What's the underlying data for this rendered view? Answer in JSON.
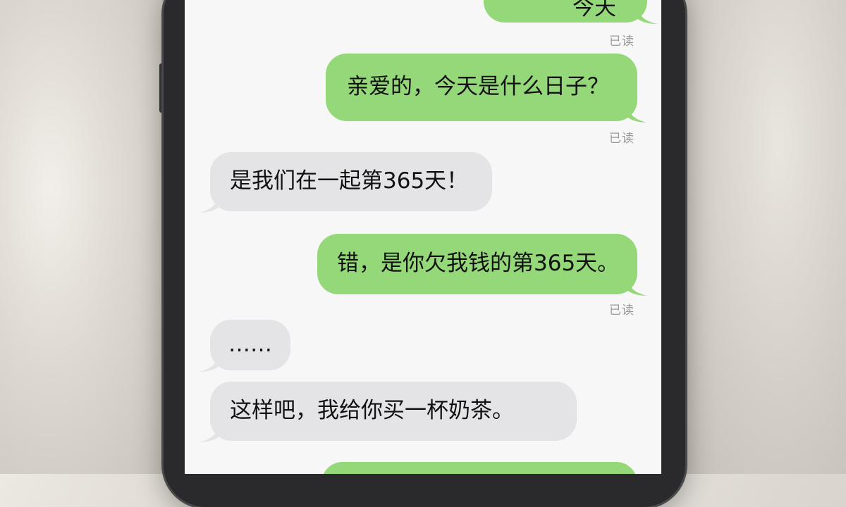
{
  "colors": {
    "outgoing_bubble": "#95d879",
    "incoming_bubble": "#e4e4e6",
    "screen_background": "#f7f7f7"
  },
  "messages": [
    {
      "direction": "outgoing",
      "text": "今天",
      "partially_visible": true
    },
    {
      "direction": "outgoing",
      "status": "已读"
    },
    {
      "direction": "outgoing",
      "text": "亲爱的，今天是什么日子？"
    },
    {
      "direction": "outgoing",
      "status": "已读"
    },
    {
      "direction": "incoming",
      "text": "是我们在一起第365天！"
    },
    {
      "direction": "outgoing",
      "text": "错，是你欠我钱的第365天。"
    },
    {
      "direction": "outgoing",
      "status": "已读"
    },
    {
      "direction": "incoming",
      "text": "……"
    },
    {
      "direction": "incoming",
      "text": "这样吧，我给你买一杯奶茶。"
    },
    {
      "direction": "outgoing",
      "text": "",
      "partially_visible": true
    }
  ]
}
